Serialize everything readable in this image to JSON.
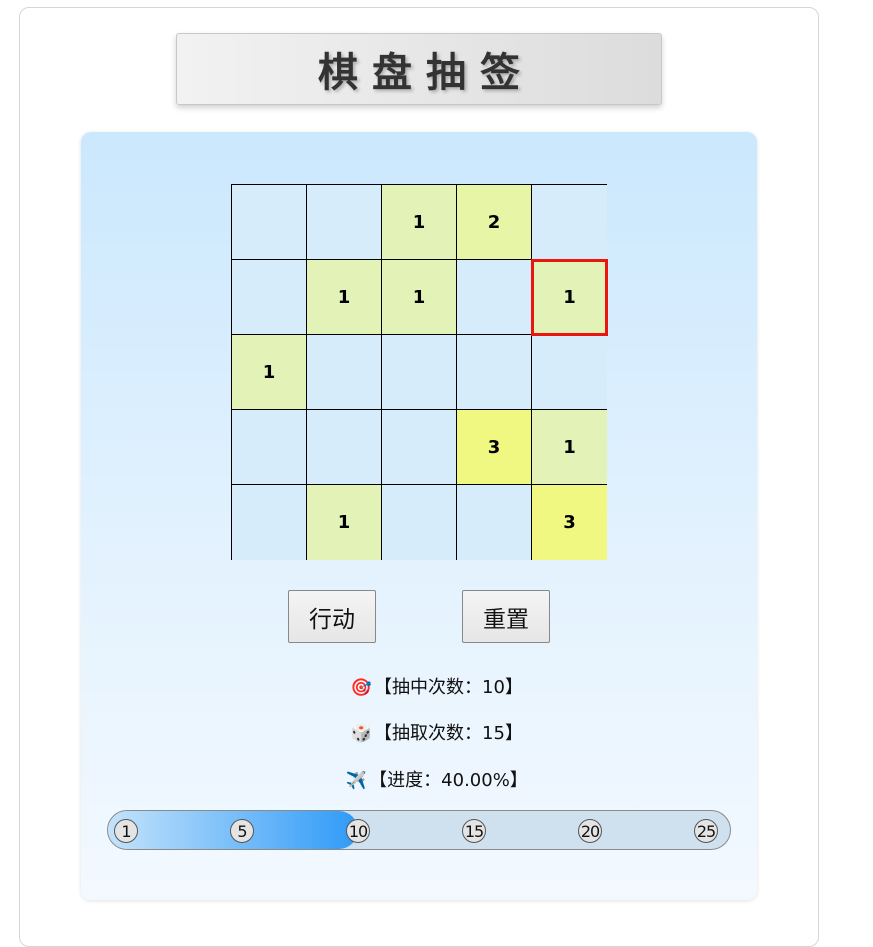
{
  "title": "棋盘抽签",
  "board": {
    "cells": [
      "",
      "",
      "1",
      "2",
      "",
      "",
      "1",
      "1",
      "",
      "1",
      "1",
      "",
      "",
      "",
      "",
      "",
      "",
      "",
      "3",
      "1",
      "",
      "1",
      "",
      "",
      "3"
    ],
    "selected_index": 9
  },
  "buttons": {
    "action_label": "行动",
    "reset_label": "重置"
  },
  "stats": {
    "hits": {
      "icon": "target-icon",
      "emoji": "🎯",
      "text": "【抽中次数：10】"
    },
    "draws": {
      "icon": "dice-icon",
      "emoji": "🎲",
      "text": "【抽取次数：15】"
    },
    "progress": {
      "icon": "airplane-icon",
      "emoji": "✈️",
      "text": "【进度：40.00%】"
    }
  },
  "progress_bar": {
    "value": 0.4,
    "markers": [
      "1",
      "5",
      "10",
      "15",
      "20",
      "25"
    ]
  },
  "colors": {
    "cell_empty": "#d6ecfb",
    "cell_level_1": "#e3f3b8",
    "cell_level_2": "#e7f5a6",
    "cell_level_3": "#f0f881",
    "selected_border": "#e8160f",
    "progress_fill": "#2f9af8"
  }
}
